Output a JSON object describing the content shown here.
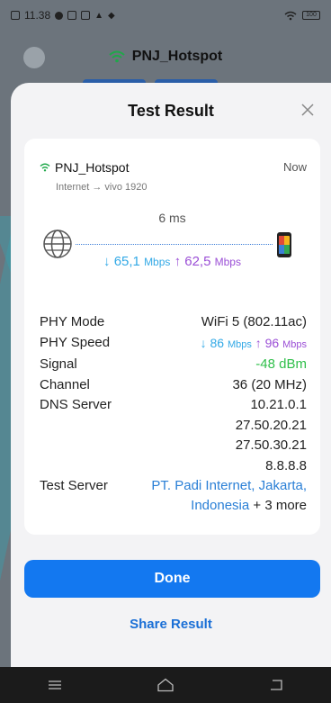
{
  "status_bar": {
    "time": "11.38",
    "battery": "100"
  },
  "background": {
    "network_title": "PNJ_Hotspot"
  },
  "sheet": {
    "title": "Test Result",
    "network": {
      "name": "PNJ_Hotspot",
      "path": "Internet → vivo 1920",
      "time": "Now"
    },
    "latency": "6 ms",
    "download": {
      "arrow": "↓",
      "value": "65,1",
      "unit": "Mbps"
    },
    "upload": {
      "arrow": "↑",
      "value": "62,5",
      "unit": "Mbps"
    },
    "details": {
      "phy_mode_label": "PHY Mode",
      "phy_mode_value": "WiFi 5 (802.11ac)",
      "phy_speed_label": "PHY Speed",
      "phy_speed_down_arrow": "↓",
      "phy_speed_down": "86",
      "phy_speed_down_unit": "Mbps",
      "phy_speed_up_arrow": "↑",
      "phy_speed_up": "96",
      "phy_speed_up_unit": "Mbps",
      "signal_label": "Signal",
      "signal_value": "-48 dBm",
      "channel_label": "Channel",
      "channel_value": "36 (20 MHz)",
      "dns_label": "DNS Server",
      "dns_servers": [
        "10.21.0.1",
        "27.50.20.21",
        "27.50.30.21",
        "8.8.8.8"
      ],
      "test_server_label": "Test Server",
      "test_server_link": "PT. Padi Internet, Jakarta, Indonesia",
      "test_server_more": " + 3 more"
    },
    "done_label": "Done",
    "share_label": "Share Result"
  },
  "colors": {
    "accent": "#1378f0",
    "download": "#33a9e6",
    "upload": "#9b4fd6",
    "signal_good": "#2fbf4a"
  }
}
